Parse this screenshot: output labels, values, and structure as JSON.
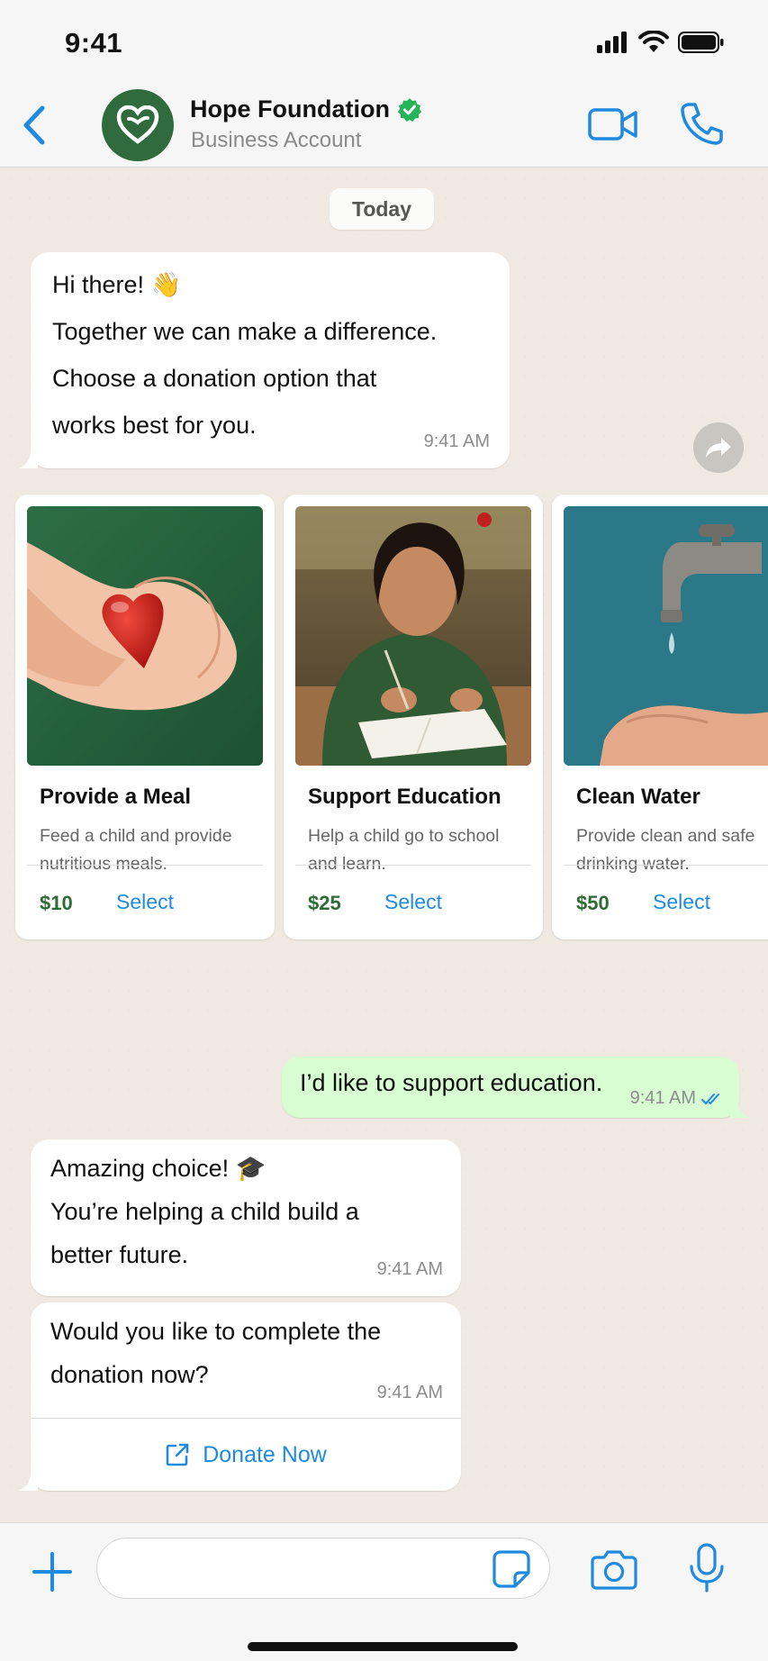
{
  "status_bar": {
    "time": "9:41"
  },
  "header": {
    "name": "Hope Foundation",
    "subtitle": "Business Account",
    "verified": true
  },
  "chat": {
    "date_label": "Today",
    "welcome": {
      "lines": [
        "Hi there! 👋",
        "Together we can make a difference.",
        "Choose a donation option that",
        "works best for you."
      ],
      "time": "9:41 AM"
    },
    "cards": [
      {
        "title": "Provide a Meal",
        "desc": "Feed a child and provide nutritious meals.",
        "price": "$10",
        "select_label": "Select",
        "image": "heart-in-hands"
      },
      {
        "title": "Support Education",
        "desc": "Help a child go to school and learn.",
        "price": "$25",
        "select_label": "Select",
        "image": "child-writing"
      },
      {
        "title": "Clean Water",
        "desc": "Provide clean and safe drinking water.",
        "price": "$50",
        "select_label": "Select",
        "image": "water-tap"
      }
    ],
    "outgoing": {
      "text": "I’d like to support education.",
      "time": "9:41 AM"
    },
    "reply1": {
      "lines": [
        "Amazing choice! 🎓",
        "You’re helping a child build a",
        "better future."
      ],
      "time": "9:41 AM"
    },
    "reply2": {
      "lines": [
        "Would you like to complete the",
        "donation now?"
      ],
      "time": "9:41 AM",
      "button_label": "Donate Now"
    }
  },
  "composer": {
    "placeholder": ""
  },
  "colors": {
    "accent": "#1f8ae0",
    "brand": "#2f6b3c",
    "price": "#2e6b35",
    "outgoing_bubble": "#d9fdd3",
    "verified": "#25b45a"
  }
}
